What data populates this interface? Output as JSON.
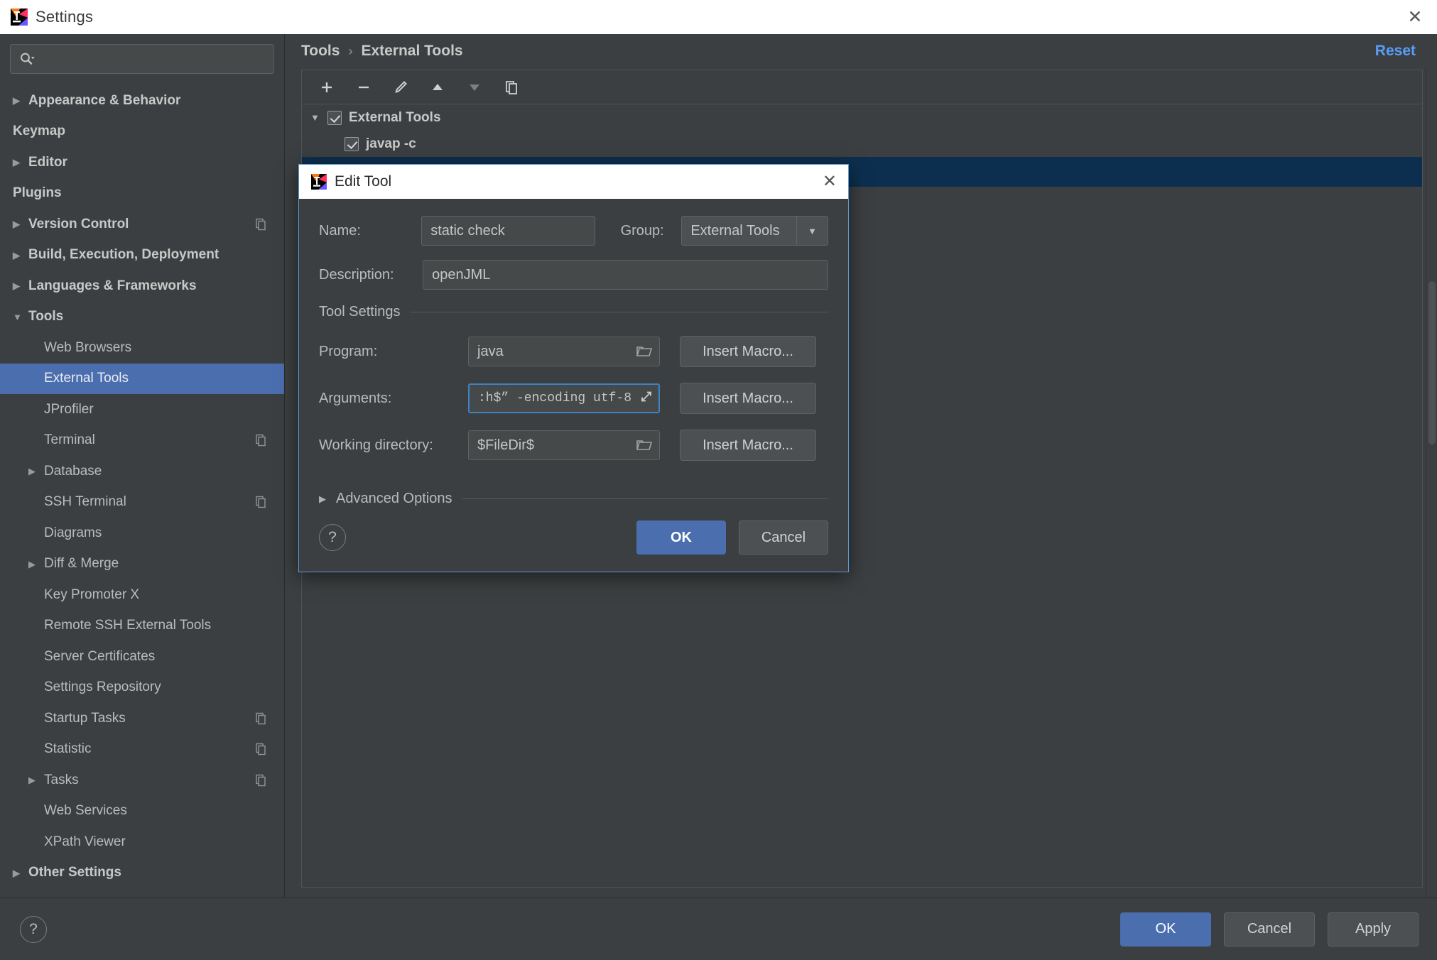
{
  "window": {
    "title": "Settings",
    "icon": "intellij-logo-icon",
    "close_label": "✕"
  },
  "search": {
    "value": "",
    "placeholder": "",
    "icon": "search-icon"
  },
  "sidebar": {
    "items": [
      {
        "label": "Appearance & Behavior",
        "level": 0,
        "expandable": true,
        "expanded": false,
        "selected": false,
        "badge": false
      },
      {
        "label": "Keymap",
        "level": 0,
        "expandable": false,
        "expanded": false,
        "selected": false,
        "badge": false
      },
      {
        "label": "Editor",
        "level": 0,
        "expandable": true,
        "expanded": false,
        "selected": false,
        "badge": false
      },
      {
        "label": "Plugins",
        "level": 0,
        "expandable": false,
        "expanded": false,
        "selected": false,
        "badge": false
      },
      {
        "label": "Version Control",
        "level": 0,
        "expandable": true,
        "expanded": false,
        "selected": false,
        "badge": true
      },
      {
        "label": "Build, Execution, Deployment",
        "level": 0,
        "expandable": true,
        "expanded": false,
        "selected": false,
        "badge": false
      },
      {
        "label": "Languages & Frameworks",
        "level": 0,
        "expandable": true,
        "expanded": false,
        "selected": false,
        "badge": false
      },
      {
        "label": "Tools",
        "level": 0,
        "expandable": true,
        "expanded": true,
        "selected": false,
        "badge": false
      },
      {
        "label": "Web Browsers",
        "level": 1,
        "expandable": false,
        "expanded": false,
        "selected": false,
        "badge": false
      },
      {
        "label": "External Tools",
        "level": 1,
        "expandable": false,
        "expanded": false,
        "selected": true,
        "badge": false
      },
      {
        "label": "JProfiler",
        "level": 1,
        "expandable": false,
        "expanded": false,
        "selected": false,
        "badge": false
      },
      {
        "label": "Terminal",
        "level": 1,
        "expandable": false,
        "expanded": false,
        "selected": false,
        "badge": true
      },
      {
        "label": "Database",
        "level": 1,
        "expandable": true,
        "expanded": false,
        "selected": false,
        "badge": false
      },
      {
        "label": "SSH Terminal",
        "level": 1,
        "expandable": false,
        "expanded": false,
        "selected": false,
        "badge": true
      },
      {
        "label": "Diagrams",
        "level": 1,
        "expandable": false,
        "expanded": false,
        "selected": false,
        "badge": false
      },
      {
        "label": "Diff & Merge",
        "level": 1,
        "expandable": true,
        "expanded": false,
        "selected": false,
        "badge": false
      },
      {
        "label": "Key Promoter X",
        "level": 1,
        "expandable": false,
        "expanded": false,
        "selected": false,
        "badge": false
      },
      {
        "label": "Remote SSH External Tools",
        "level": 1,
        "expandable": false,
        "expanded": false,
        "selected": false,
        "badge": false
      },
      {
        "label": "Server Certificates",
        "level": 1,
        "expandable": false,
        "expanded": false,
        "selected": false,
        "badge": false
      },
      {
        "label": "Settings Repository",
        "level": 1,
        "expandable": false,
        "expanded": false,
        "selected": false,
        "badge": false
      },
      {
        "label": "Startup Tasks",
        "level": 1,
        "expandable": false,
        "expanded": false,
        "selected": false,
        "badge": true
      },
      {
        "label": "Statistic",
        "level": 1,
        "expandable": false,
        "expanded": false,
        "selected": false,
        "badge": true
      },
      {
        "label": "Tasks",
        "level": 1,
        "expandable": true,
        "expanded": false,
        "selected": false,
        "badge": true
      },
      {
        "label": "Web Services",
        "level": 1,
        "expandable": false,
        "expanded": false,
        "selected": false,
        "badge": false
      },
      {
        "label": "XPath Viewer",
        "level": 1,
        "expandable": false,
        "expanded": false,
        "selected": false,
        "badge": false
      },
      {
        "label": "Other Settings",
        "level": 0,
        "expandable": true,
        "expanded": false,
        "selected": false,
        "badge": false
      }
    ]
  },
  "breadcrumb": {
    "root": "Tools",
    "separator": "›",
    "current": "External Tools",
    "reset_label": "Reset"
  },
  "toolbar": {
    "buttons": [
      {
        "name": "add-button",
        "glyph": "+",
        "enabled": true
      },
      {
        "name": "remove-button",
        "glyph": "−",
        "enabled": true
      },
      {
        "name": "edit-button",
        "glyph": "pencil-icon",
        "enabled": true
      },
      {
        "name": "move-up-button",
        "glyph": "▲",
        "enabled": true
      },
      {
        "name": "move-down-button",
        "glyph": "▼",
        "enabled": false
      },
      {
        "name": "copy-button",
        "glyph": "copy-icon",
        "enabled": true
      }
    ]
  },
  "tools_tree": {
    "group": {
      "label": "External Tools",
      "checked": true,
      "expanded": true
    },
    "children": [
      {
        "label": "javap -c",
        "checked": true
      }
    ]
  },
  "dialog": {
    "title": "Edit Tool",
    "icon": "intellij-logo-icon",
    "close_label": "✕",
    "name_label": "Name:",
    "name_value": "static check",
    "group_label": "Group:",
    "group_value": "External Tools",
    "description_label": "Description:",
    "description_value": "openJML",
    "tool_settings_label": "Tool Settings",
    "program_label": "Program:",
    "program_value": "java",
    "arguments_label": "Arguments:",
    "arguments_value": ":h$” -encoding utf-8",
    "working_directory_label": "Working directory:",
    "working_directory_value": "$FileDir$",
    "insert_macro_label": "Insert Macro...",
    "advanced_options_label": "Advanced Options",
    "help_label": "?",
    "ok_label": "OK",
    "cancel_label": "Cancel"
  },
  "footer": {
    "help_label": "?",
    "ok_label": "OK",
    "cancel_label": "Cancel",
    "apply_label": "Apply"
  },
  "colors": {
    "accent": "#4b6eaf",
    "link": "#589df6",
    "panel_bg": "#3c3f41",
    "field_bg": "#45494a",
    "focus_border": "#3d83c4",
    "selection_unfocused": "#0d2f4f"
  }
}
